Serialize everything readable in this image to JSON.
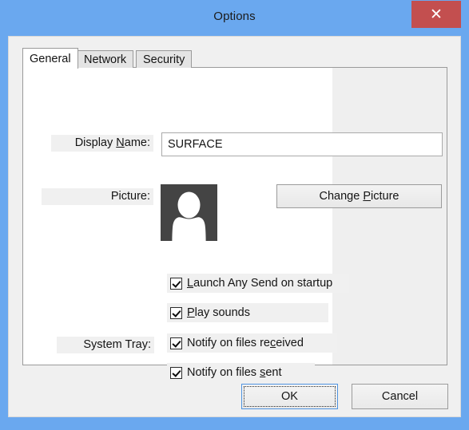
{
  "window": {
    "title": "Options",
    "close_icon": "close-icon",
    "close_glyph": "✕",
    "frame_color": "#6aa8ef",
    "close_button_color": "#c34f4f"
  },
  "tabs": [
    {
      "label": "General",
      "active": true
    },
    {
      "label": "Network",
      "active": false
    },
    {
      "label": "Security",
      "active": false
    }
  ],
  "general": {
    "display_name": {
      "label_prefix": "Display ",
      "label_accel": "N",
      "label_suffix": "ame:",
      "value": "SURFACE",
      "placeholder": ""
    },
    "picture": {
      "label": "Picture:",
      "avatar_icon": "user-silhouette-icon",
      "avatar_background": "#444444",
      "avatar_foreground": "#ffffff",
      "change_button": {
        "prefix": "Change ",
        "accel": "P",
        "suffix": "icture"
      }
    },
    "checkboxes": [
      {
        "prefix": "",
        "accel": "L",
        "suffix": "aunch Any Send on startup",
        "checked": true
      },
      {
        "prefix": "",
        "accel": "P",
        "suffix": "lay sounds",
        "checked": true
      },
      {
        "prefix": "Notify on files re",
        "accel": "c",
        "suffix": "eived",
        "checked": true
      },
      {
        "prefix": "Notify on files ",
        "accel": "s",
        "suffix": "ent",
        "checked": true
      }
    ],
    "system_tray_label": "System Tray:"
  },
  "footer": {
    "ok_label": "OK",
    "cancel_label": "Cancel"
  }
}
